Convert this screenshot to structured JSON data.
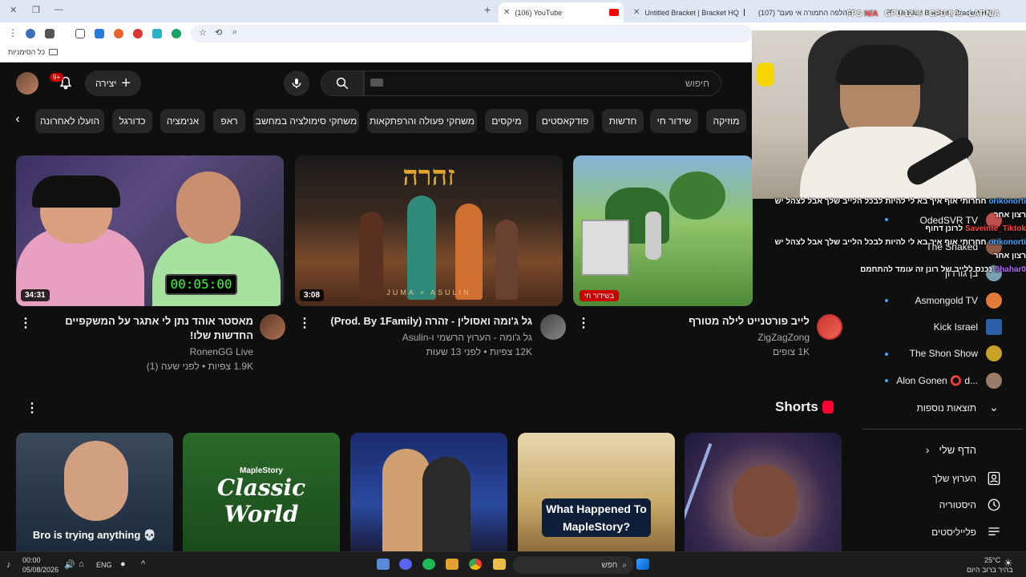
{
  "browser": {
    "tabs": [
      {
        "title": "(106) YouTube",
        "active": true
      },
      {
        "title": "Untitled Bracket | Bracket HQ",
        "active": false
      },
      {
        "title": "(107) \"ההלפה התמורה אי פעם\"",
        "active": false
      },
      {
        "title": "Untitled Bracket | Bracket HQ",
        "active": false
      }
    ],
    "bookmarks_label": "כל הסימניות"
  },
  "overlay_stats": {
    "fps_label": "FPS",
    "fps_value": "N/A",
    "gpu_label": "GPU",
    "gpu_value": "12 %",
    "cpu_label": "CPU",
    "cpu_value": "8 %",
    "lat_label": "LAT",
    "lat_value": "N/A"
  },
  "header": {
    "notification_count": "9+",
    "create_label": "יצירה",
    "search_placeholder": "חיפוש"
  },
  "chips": [
    "מוזיקה",
    "שידור חי",
    "חדשות",
    "פודקאסטים",
    "מיקסים",
    "משחקי פעולה והרפתקאות",
    "משחקי סימולציה במחשב",
    "ראפ",
    "אנימציה",
    "כדורגל",
    "הועלו לאחרונה"
  ],
  "videos": [
    {
      "title": "לייב פורטנייט לילה מטורף",
      "channel": "ZigZagZong",
      "meta": "1K צופים",
      "badge": "בשידור חי"
    },
    {
      "title": "גל ג'ומה ואסולין - זהרה (Prod. By 1Family)",
      "channel": "גל ג'ומה - הערוץ הרשמי ו-Asulin",
      "meta": "12K צפיות • לפני 13 שעות",
      "duration": "3:08",
      "thumb_text": "זהרה",
      "thumb_sub": "JUMA × ASULIN"
    },
    {
      "title": "מאסטר אוהד נתן לי אתגר על המשקפיים החדשות שלו!",
      "channel": "RonenGG Live",
      "meta": "1.9K צפיות • לפני שעה (1)",
      "duration": "34:31",
      "thumb_timer": "00:05:00"
    }
  ],
  "shorts": {
    "title": "Shorts",
    "items": [
      {
        "caption": ""
      },
      {
        "caption": "What Happened To MapleStory?"
      },
      {
        "caption": ""
      },
      {
        "caption": "Classic World",
        "sub": "MapleStory"
      },
      {
        "caption": "Bro is trying anything 💀"
      }
    ]
  },
  "subscriptions": [
    {
      "name": "OdedSVR TV",
      "color": "#c0504d",
      "dot": true
    },
    {
      "name": "The Shaked",
      "color": "#8a5a44",
      "dot": false
    },
    {
      "name": "בן גורדון",
      "color": "#7aa0b0",
      "dot": false
    },
    {
      "name": "Asmongold TV",
      "color": "#e07b39",
      "dot": true
    },
    {
      "name": "Kick Israel",
      "color": "#2d5fa8",
      "dot": false
    },
    {
      "name": "The Shon Show",
      "color": "#c9a227",
      "dot": true
    },
    {
      "name": "Alon Gonen ⭕ d...",
      "color": "#9b7b6a",
      "dot": true
    }
  ],
  "sidebar": {
    "show_more": "תוצאות נוספות",
    "you_section": "הדף שלי",
    "your_channel": "הערוץ שלך",
    "history": "היסטוריה",
    "playlists": "פלייליסטים"
  },
  "chat": [
    {
      "user": "orikonorti",
      "msg": "חחרותי אוף איך בא לי להיות לבכל הלייב שלך אבל לצהל יש"
    },
    {
      "user": "",
      "msg": "רצון אחר"
    },
    {
      "user": "Saveinte_Tiktok",
      "msg": "לרונן דחוף"
    },
    {
      "user": "orikonorti",
      "msg": "חחרותי אוף איך בא לי להיות לבכל הלייב שלך אבל לצהל יש"
    },
    {
      "user": "",
      "msg": "רצון אחר"
    },
    {
      "user": "Shahar0",
      "msg": "נכנס ללייב של רונן זה עומד להתחמם"
    }
  ],
  "taskbar": {
    "time": "00:00",
    "date": "05/08/2026",
    "lang": "ENG",
    "search_label": "חפש",
    "weather_temp": "25°C",
    "weather_desc": "בהיר ברוב היום"
  }
}
